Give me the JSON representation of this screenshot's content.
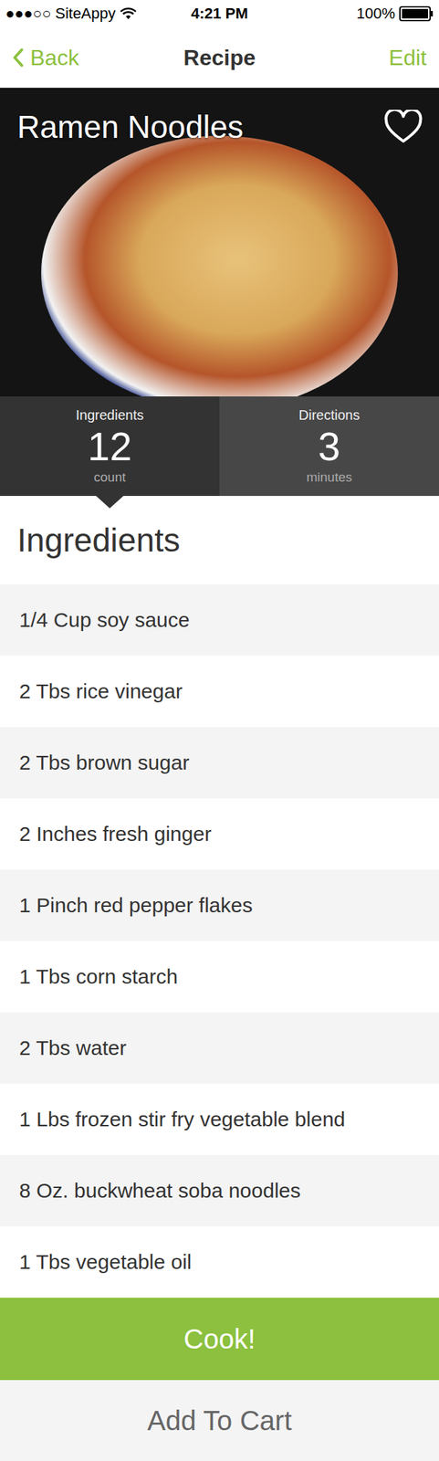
{
  "status_bar": {
    "signal": "●●●○○",
    "carrier": "SiteAppy",
    "time": "4:21 PM",
    "battery": "100%"
  },
  "nav": {
    "back": "Back",
    "title": "Recipe",
    "edit": "Edit"
  },
  "recipe": {
    "title": "Ramen Noodles",
    "favorite": false
  },
  "tabs": [
    {
      "label": "Ingredients",
      "value": "12",
      "unit": "count",
      "selected": true
    },
    {
      "label": "Directions",
      "value": "3",
      "unit": "minutes",
      "selected": false
    }
  ],
  "section_title": "Ingredients",
  "ingredients": [
    "1/4 Cup soy sauce",
    "2 Tbs rice vinegar",
    "2 Tbs brown sugar",
    "2 Inches fresh ginger",
    "1 Pinch red pepper flakes",
    "1 Tbs corn starch",
    "2 Tbs water",
    "1 Lbs frozen stir fry vegetable blend",
    "8 Oz. buckwheat soba noodles",
    "1 Tbs vegetable oil"
  ],
  "buttons": {
    "cook": "Cook!",
    "cart": "Add To Cart"
  }
}
